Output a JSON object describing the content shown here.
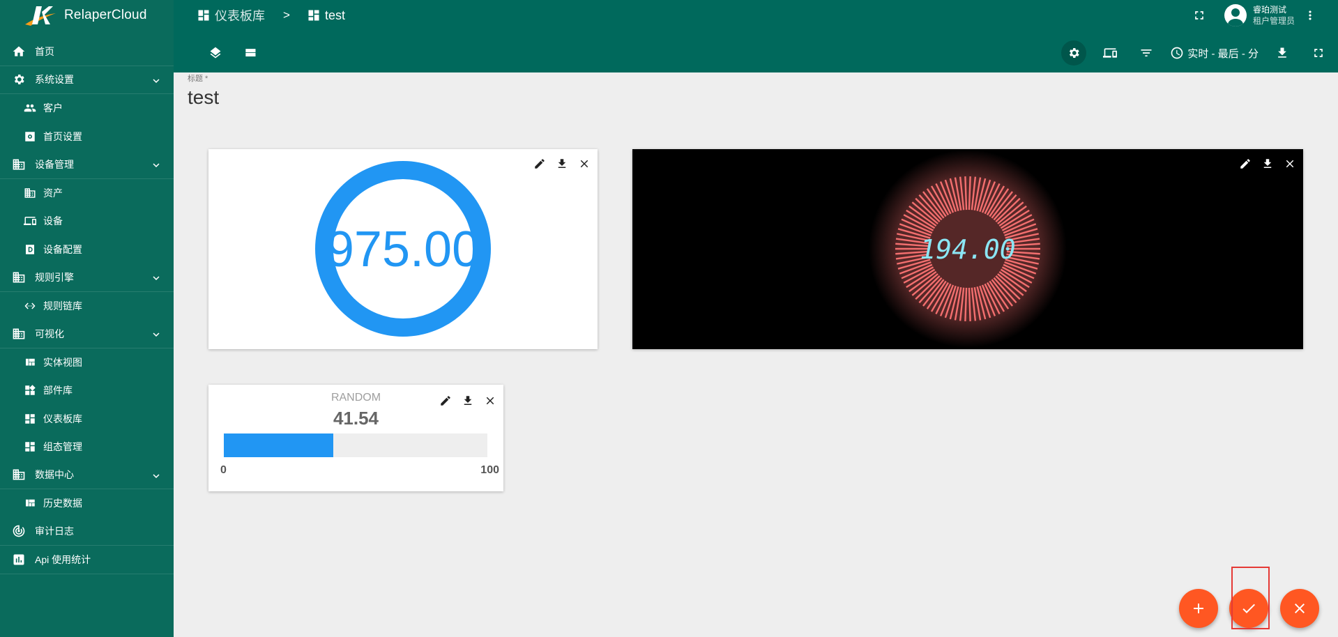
{
  "app": {
    "name": "RelaperCloud"
  },
  "sidebar": {
    "items": [
      {
        "label": "首页",
        "icon": "home-icon",
        "level": "top"
      },
      {
        "label": "系统设置",
        "icon": "gear-icon",
        "level": "top",
        "expandable": true
      },
      {
        "label": "客户",
        "icon": "people-icon",
        "level": "sub"
      },
      {
        "label": "首页设置",
        "icon": "settings-box-icon",
        "level": "sub"
      },
      {
        "label": "设备管理",
        "icon": "domain-icon",
        "level": "top",
        "expandable": true
      },
      {
        "label": "资产",
        "icon": "domain-icon",
        "level": "sub"
      },
      {
        "label": "设备",
        "icon": "devices-icon",
        "level": "sub"
      },
      {
        "label": "设备配置",
        "icon": "profile-d-icon",
        "level": "sub"
      },
      {
        "label": "规则引擎",
        "icon": "domain-icon",
        "level": "top",
        "expandable": true
      },
      {
        "label": "规则链库",
        "icon": "code-dots-icon",
        "level": "sub"
      },
      {
        "label": "可视化",
        "icon": "domain-icon",
        "level": "top",
        "expandable": true
      },
      {
        "label": "实体视图",
        "icon": "view-quilt-icon",
        "level": "sub"
      },
      {
        "label": "部件库",
        "icon": "widgets-icon",
        "level": "sub"
      },
      {
        "label": "仪表板库",
        "icon": "dashboard-icon",
        "level": "sub"
      },
      {
        "label": "组态管理",
        "icon": "dashboard-icon",
        "level": "sub"
      },
      {
        "label": "数据中心",
        "icon": "domain-icon",
        "level": "top",
        "expandable": true
      },
      {
        "label": "历史数据",
        "icon": "view-quilt-icon",
        "level": "sub"
      },
      {
        "label": "审计日志",
        "icon": "track-changes-icon",
        "level": "top"
      },
      {
        "label": "Api 使用统计",
        "icon": "insert-chart-icon",
        "level": "top"
      }
    ]
  },
  "header": {
    "breadcrumb_parent": "仪表板库",
    "breadcrumb_separator": ">",
    "breadcrumb_current": "test",
    "user_name": "睿珀测试",
    "user_role": "租户管理员"
  },
  "toolbar": {
    "realtime_label": "实时 - 最后 - 分"
  },
  "dashboard": {
    "title_label": "标题 *",
    "title": "test"
  },
  "widgets": {
    "donut": {
      "value_text": "975.00",
      "color": "#2196f3"
    },
    "lcd": {
      "value_text": "194.00",
      "ring_color": "#f36f6f",
      "digit_color": "#8be6f4"
    },
    "bar": {
      "title": "RANDOM",
      "value_text": "41.54",
      "value": 41.54,
      "min_label": "0",
      "max_label": "100",
      "min": 0,
      "max": 100,
      "color": "#2196f3"
    }
  },
  "colors": {
    "primary": "#00695c",
    "sidebar": "#0a6b5c",
    "fab": "#ff5722",
    "highlight": "#e53935"
  }
}
